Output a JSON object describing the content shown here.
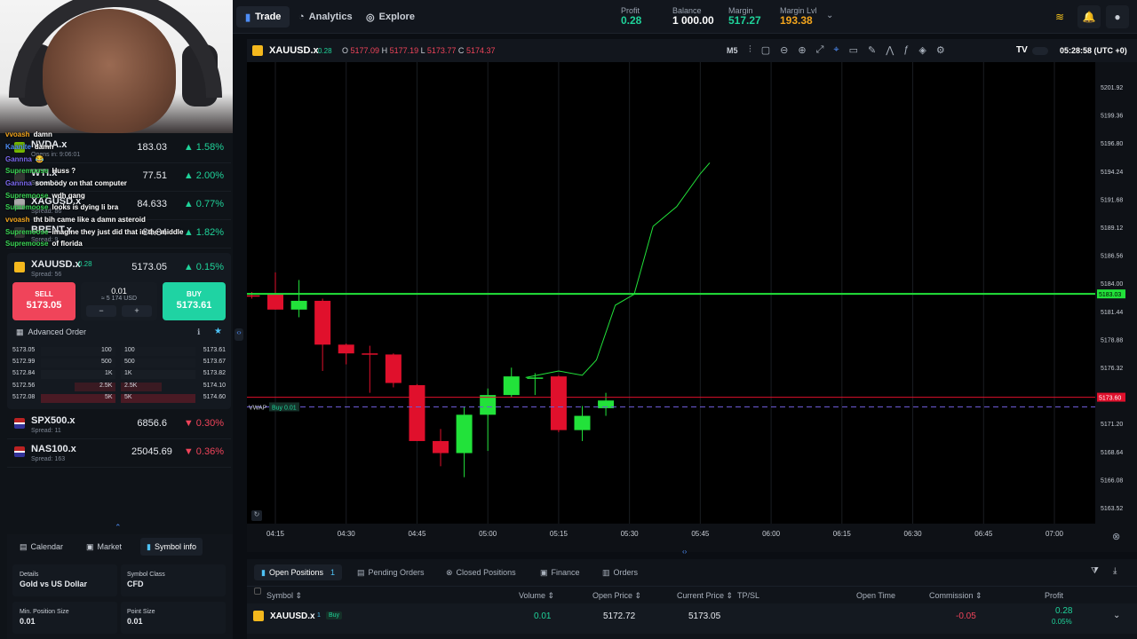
{
  "topbar": {
    "nav": [
      {
        "label": "Trade",
        "icon": "bar-chart-icon"
      },
      {
        "label": "Analytics",
        "icon": "analytics-icon"
      },
      {
        "label": "Explore",
        "icon": "compass-icon"
      }
    ],
    "profit": {
      "label": "Profit",
      "value": "0.28",
      "unit": "USD"
    },
    "balance": {
      "label": "Balance",
      "value": "1 000.00",
      "unit": "USD"
    },
    "margin": {
      "label": "Margin",
      "value": "517.27",
      "unit": "USD"
    },
    "margin_lvl": {
      "label": "Margin Lvl",
      "value": "193.38",
      "unit": "%"
    }
  },
  "chat": [
    {
      "user": "vvoash",
      "msg": "damn",
      "color": "#f4a61d"
    },
    {
      "user": "Kaanite",
      "msg": "damn",
      "color": "#4e8df5"
    },
    {
      "user": "Gannna",
      "msg": "😂",
      "color": "#7b68ee"
    },
    {
      "user": "Supremoose",
      "msg": "Huss ?",
      "color": "#39d353"
    },
    {
      "user": "Gannna",
      "msg": "sombody on that computer",
      "color": "#7b68ee"
    },
    {
      "user": "Supremoose",
      "msg": "wdh gang",
      "color": "#39d353"
    },
    {
      "user": "Supremoose",
      "msg": "looks is dying li bra",
      "color": "#39d353"
    },
    {
      "user": "vvoash",
      "msg": "tht bih came like a damn asteroid",
      "color": "#f4a61d"
    },
    {
      "user": "Supremoose",
      "msg": "imagine they just did that in the middle",
      "color": "#39d353"
    },
    {
      "user": "Supremoose",
      "msg": "of florida",
      "color": "#39d353"
    }
  ],
  "instruments": [
    {
      "name": "NVDA.x",
      "spread": "Opens in: 9:06:01",
      "price": "183.03",
      "change": "1.58%",
      "dir": "up",
      "color": "#76b900"
    },
    {
      "name": "WTI.x",
      "spread": "Spread: 9",
      "price": "77.51",
      "change": "2.00%",
      "dir": "up",
      "color": "#333"
    },
    {
      "name": "XAGUSD.x",
      "spread": "Spread: 86",
      "price": "84.633",
      "change": "0.77%",
      "dir": "up",
      "color": "#aaa"
    },
    {
      "name": "BRENT.x",
      "spread": "Spread: 9",
      "price": "84.34",
      "change": "1.82%",
      "dir": "up",
      "color": "#333"
    }
  ],
  "selected": {
    "name": "XAUUSD.x",
    "spread_badge": "0.28",
    "spread": "Spread: 56",
    "price": "5173.05",
    "change": "0.15%",
    "sell_label": "SELL",
    "sell_price": "5173.05",
    "buy_label": "BUY",
    "buy_price": "5173.61",
    "qty": "0.01",
    "qty_usd": "≈ 5 174 USD",
    "minus": "−",
    "plus": "+",
    "advanced": "Advanced Order"
  },
  "dom": [
    {
      "bp": "5173.05",
      "bv": "100",
      "av": "100",
      "ap": "5173.61"
    },
    {
      "bp": "5172.99",
      "bv": "500",
      "av": "500",
      "ap": "5173.67"
    },
    {
      "bp": "5172.84",
      "bv": "1K",
      "av": "1K",
      "ap": "5173.82"
    },
    {
      "bp": "5172.56",
      "bv": "2.5K",
      "av": "2.5K",
      "ap": "5174.10"
    },
    {
      "bp": "5172.08",
      "bv": "5K",
      "av": "5K",
      "ap": "5174.60"
    }
  ],
  "instruments2": [
    {
      "name": "SPX500.x",
      "spread": "Spread: 11",
      "price": "6856.6",
      "change": "0.30%",
      "dir": "dn"
    },
    {
      "name": "NAS100.x",
      "spread": "Spread: 163",
      "price": "25045.69",
      "change": "0.36%",
      "dir": "dn"
    }
  ],
  "left_tabs": [
    {
      "label": "Calendar"
    },
    {
      "label": "Market"
    },
    {
      "label": "Symbol info"
    }
  ],
  "details": {
    "details_label": "Details",
    "details_value": "Gold vs US Dollar",
    "class_label": "Symbol Class",
    "class_value": "CFD",
    "minpos_label": "Min. Position Size",
    "minpos_value": "0.01",
    "point_label": "Point Size",
    "point_value": "0.01"
  },
  "chartbar": {
    "symbol": "XAUUSD.x",
    "badge": "0.28",
    "o_label": "O",
    "o": "5177.09",
    "h_label": "H",
    "h": "5177.19",
    "l_label": "L",
    "l": "5173.77",
    "c_label": "C",
    "c": "5174.37",
    "timeframe": "M5",
    "clock": "05:28:58 (UTC +0)"
  },
  "chart_data": {
    "type": "candlestick",
    "price_ticks": [
      "5201.92",
      "5199.36",
      "5196.80",
      "5194.24",
      "5191.68",
      "5189.12",
      "5186.56",
      "5184.00",
      "5181.44",
      "5178.88",
      "5176.32",
      "5173.76",
      "5171.20",
      "5168.64",
      "5166.08",
      "5163.52"
    ],
    "time_ticks": [
      "04:15",
      "04:30",
      "04:45",
      "05:00",
      "05:15",
      "05:30",
      "05:45",
      "06:00",
      "06:15",
      "06:30",
      "06:45",
      "07:00"
    ],
    "candles": [
      {
        "t": "04:10",
        "o": 5182.9,
        "h": 5183.2,
        "l": 5182.6,
        "c": 5182.8
      },
      {
        "t": "04:15",
        "o": 5183.0,
        "h": 5185.0,
        "l": 5181.6,
        "c": 5181.6
      },
      {
        "t": "04:20",
        "o": 5181.6,
        "h": 5184.3,
        "l": 5180.9,
        "c": 5182.4
      },
      {
        "t": "04:25",
        "o": 5182.4,
        "h": 5182.6,
        "l": 5176.0,
        "c": 5178.4
      },
      {
        "t": "04:30",
        "o": 5178.4,
        "h": 5178.5,
        "l": 5176.6,
        "c": 5177.6
      },
      {
        "t": "04:35",
        "o": 5177.6,
        "h": 5178.3,
        "l": 5174.0,
        "c": 5177.5
      },
      {
        "t": "04:40",
        "o": 5177.5,
        "h": 5177.6,
        "l": 5174.5,
        "c": 5174.9
      },
      {
        "t": "04:45",
        "o": 5174.7,
        "h": 5174.8,
        "l": 5169.6,
        "c": 5169.6
      },
      {
        "t": "04:50",
        "o": 5169.6,
        "h": 5170.7,
        "l": 5167.3,
        "c": 5168.5
      },
      {
        "t": "04:55",
        "o": 5168.5,
        "h": 5172.7,
        "l": 5166.3,
        "c": 5172.0
      },
      {
        "t": "05:00",
        "o": 5172.0,
        "h": 5174.4,
        "l": 5168.7,
        "c": 5173.8
      },
      {
        "t": "05:05",
        "o": 5173.8,
        "h": 5176.3,
        "l": 5173.6,
        "c": 5175.5
      },
      {
        "t": "05:10",
        "o": 5175.4,
        "h": 5175.8,
        "l": 5173.8,
        "c": 5175.4
      },
      {
        "t": "05:15",
        "o": 5175.5,
        "h": 5175.6,
        "l": 5170.4,
        "c": 5170.6
      },
      {
        "t": "05:20",
        "o": 5170.6,
        "h": 5172.8,
        "l": 5169.6,
        "c": 5171.9
      },
      {
        "t": "05:25",
        "o": 5172.6,
        "h": 5174.0,
        "l": 5171.9,
        "c": 5173.3
      }
    ],
    "ask_line": "5183.03",
    "bid_label": "5173.60",
    "vwap_label": "VWAP",
    "position_label": "Buy 0.01"
  },
  "bottom": {
    "tabs": [
      {
        "label": "Open Positions",
        "badge": "1"
      },
      {
        "label": "Pending Orders"
      },
      {
        "label": "Closed Positions"
      },
      {
        "label": "Finance"
      },
      {
        "label": "Orders"
      }
    ],
    "cols": [
      "Symbol",
      "Volume",
      "Open Price",
      "Current Price",
      "TP/SL",
      "Open Time",
      "Commission",
      "Profit"
    ],
    "row": {
      "symbol": "XAUUSD.x",
      "badge": "1",
      "side": "Buy",
      "volume": "0.01",
      "open_price": "5172.72",
      "current_price": "5173.05",
      "commission": "-0.05",
      "profit": "0.28",
      "profit_pct": "0.05%"
    }
  }
}
